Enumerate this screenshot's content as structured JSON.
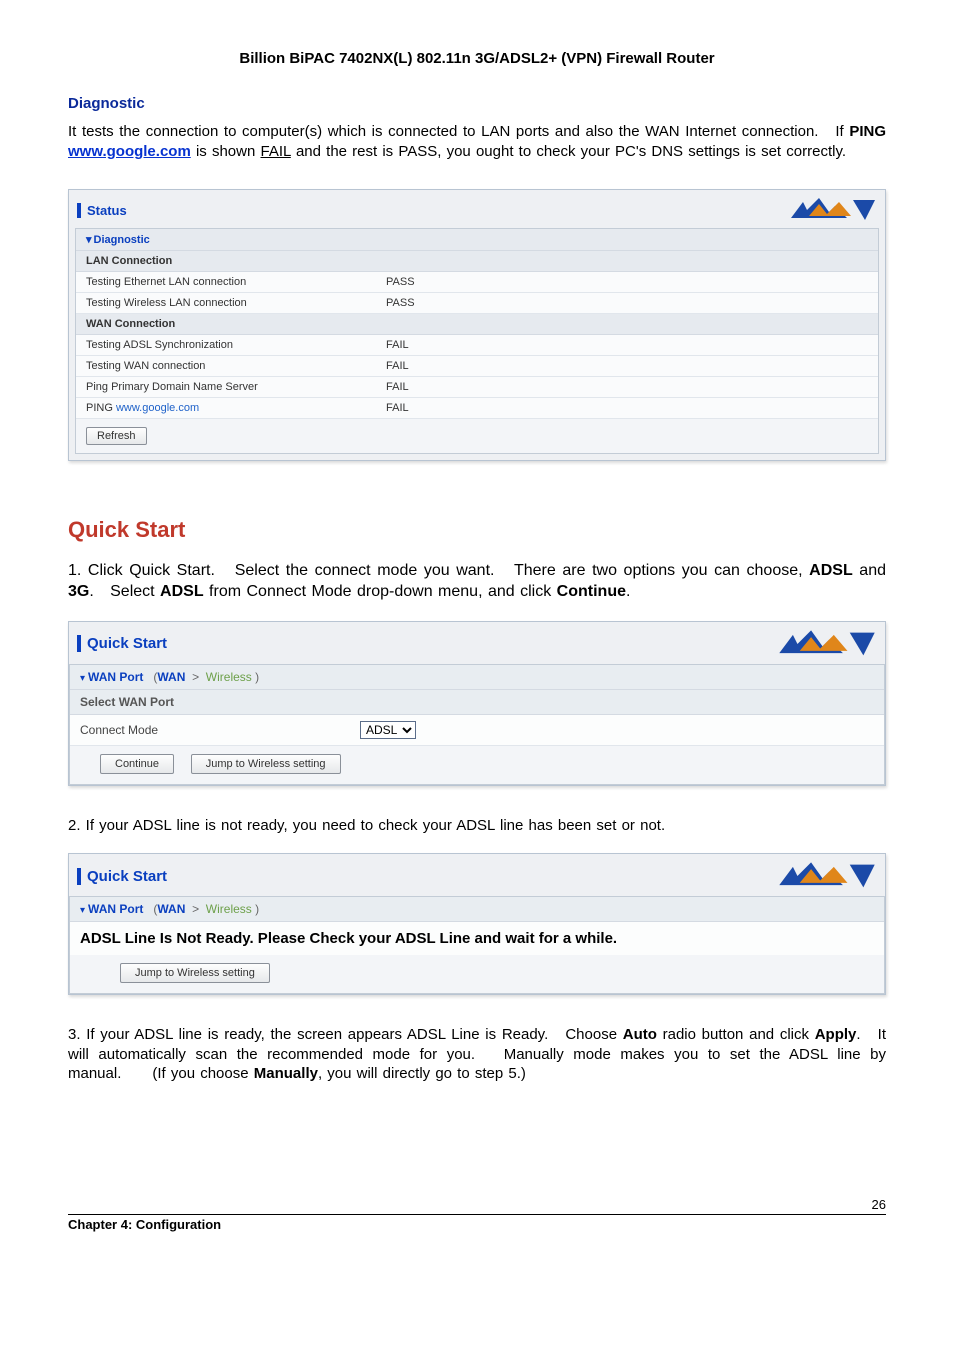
{
  "doc_title": "Billion BiPAC 7402NX(L) 802.11n 3G/ADSL2+ (VPN) Firewall Router",
  "diagnostic": {
    "heading": "Diagnostic",
    "intro_a": "It tests the connection to computer(s) which is connected to LAN ports and also the WAN Internet connection.   If ",
    "intro_b": "PING",
    "intro_c": " ",
    "intro_link": "www.google.com",
    "intro_d": " is shown ",
    "intro_e": "FAIL",
    "intro_f": " and the rest is PASS, you ought to check your PC's DNS settings is set correctly."
  },
  "status_panel": {
    "title": "Status",
    "nav": "Diagnostic",
    "lan_section": "LAN Connection",
    "lan_rows": [
      {
        "label": "Testing Ethernet LAN connection",
        "result": "PASS"
      },
      {
        "label": "Testing Wireless LAN connection",
        "result": "PASS"
      }
    ],
    "wan_section": "WAN Connection",
    "wan_rows": [
      {
        "label": "Testing ADSL Synchronization",
        "result": "FAIL"
      },
      {
        "label": "Testing WAN connection",
        "result": "FAIL"
      },
      {
        "label": "Ping Primary Domain Name Server",
        "result": "FAIL"
      }
    ],
    "ping_label_prefix": "PING ",
    "ping_host": "www.google.com",
    "ping_result": "FAIL",
    "refresh": "Refresh"
  },
  "quick_start": {
    "heading": "Quick Start",
    "step1_a": "1. Click Quick Start.   Select the connect mode you want.   There are two options you can choose, ",
    "step1_b": "ADSL",
    "step1_c": " and ",
    "step1_d": "3G",
    "step1_e": ".   Select ",
    "step1_f": "ADSL",
    "step1_g": " from Connect Mode drop-down menu, and click ",
    "step1_h": "Continue",
    "step1_i": "."
  },
  "qs_panel": {
    "title": "Quick Start",
    "bc_wanport": "WAN Port",
    "bc_paren_open": "(",
    "bc_wan": "WAN",
    "bc_gt": ">",
    "bc_wireless": "Wireless",
    "bc_paren_close": ")",
    "select_wan": "Select WAN Port",
    "connect_mode": "Connect Mode",
    "connect_mode_value": "ADSL",
    "continue": "Continue",
    "jump": "Jump to Wireless setting"
  },
  "step2": "2. If your ADSL line is not ready, you need to check your ADSL line has been set or not.",
  "qs_panel2": {
    "msg": "ADSL Line Is Not Ready. Please Check your ADSL Line and wait for a while."
  },
  "step3": {
    "a": "3. If your ADSL line is ready, the screen appears ADSL Line is Ready.   Choose ",
    "b": "Auto",
    "c": " radio button and click ",
    "d": "Apply",
    "e": ".   It will automatically scan the recommended mode for you.   Manually mode makes you to set the ADSL line by manual.      (If you choose ",
    "f": "Manually",
    "g": ", you will directly go to step 5.)"
  },
  "footer": {
    "chapter": "Chapter 4: Configuration",
    "page": "26"
  }
}
